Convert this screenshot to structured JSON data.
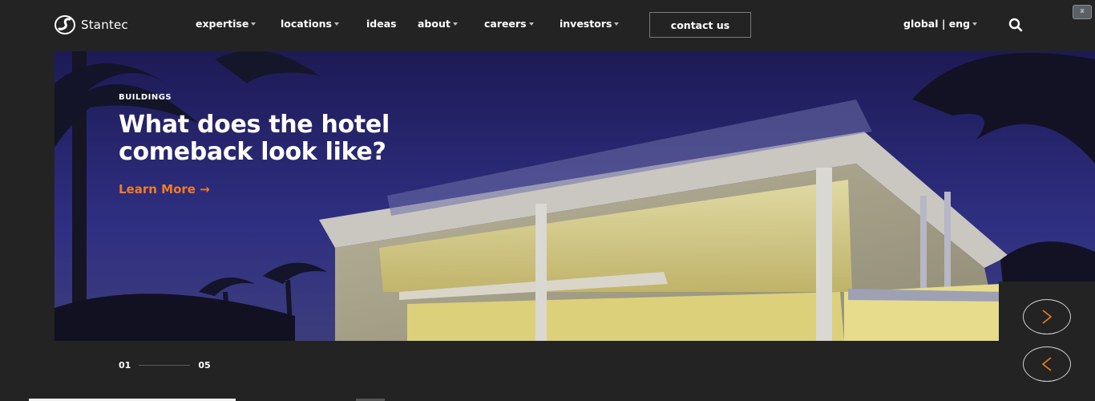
{
  "brand": {
    "name": "Stantec"
  },
  "nav": {
    "items": [
      {
        "label": "expertise",
        "dropdown": true
      },
      {
        "label": "locations",
        "dropdown": true
      },
      {
        "label": "ideas",
        "dropdown": false
      },
      {
        "label": "about",
        "dropdown": true
      },
      {
        "label": "careers",
        "dropdown": true
      },
      {
        "label": "investors",
        "dropdown": true
      }
    ],
    "contact_label": "contact us",
    "language_label": "global | eng",
    "search_icon": "search-icon"
  },
  "hero": {
    "eyebrow": "BUILDINGS",
    "headline_line1": "What does the hotel",
    "headline_line2": "comeback look like?",
    "cta_label": "Learn More →",
    "cta_color": "#f07d22"
  },
  "carousel": {
    "current": "01",
    "total": "05",
    "next_icon": "chevron-right-icon",
    "prev_icon": "chevron-left-icon",
    "arrow_color": "#f07d22"
  },
  "colors": {
    "background": "#232323",
    "accent": "#f07d22",
    "text": "#ffffff"
  }
}
